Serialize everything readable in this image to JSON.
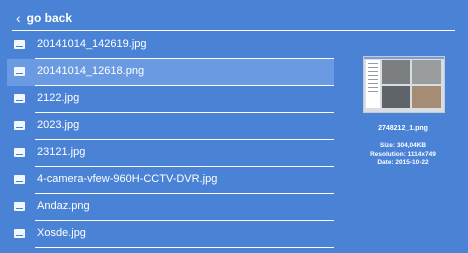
{
  "header": {
    "back_label": "go back"
  },
  "files": [
    {
      "name": "20141014_142619.jpg"
    },
    {
      "name": "20141014_12618.png"
    },
    {
      "name": "2122.jpg"
    },
    {
      "name": "2023.jpg"
    },
    {
      "name": "23121.jpg"
    },
    {
      "name": "4-camera-vfew-960H-CCTV-DVR.jpg"
    },
    {
      "name": "Andaz.png"
    },
    {
      "name": "Xosde.jpg"
    }
  ],
  "selected_index": 1,
  "details": {
    "filename": "2748212_1.png",
    "size": "Size:  304,04KB",
    "resolution": "Resolution:  1114x749",
    "date": "Date:  2015-10-22"
  },
  "colors": {
    "background": "#4a82d6",
    "selected_row": "#6a9be2"
  }
}
